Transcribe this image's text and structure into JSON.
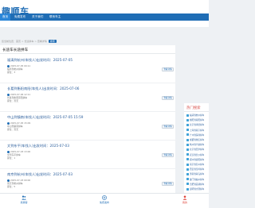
{
  "header": {
    "logo": "趣顺车"
  },
  "nav": [
    {
      "label": "首页"
    },
    {
      "label": "免费发布"
    },
    {
      "label": "关于我们"
    },
    {
      "label": "联系车主"
    }
  ],
  "breadcrumb": {
    "text": "您当前位置：首页 > 长途拼车 > 查看详情",
    "button": "搜索"
  },
  "main": {
    "title": "长途车长途拼车",
    "posts": [
      {
        "title": "福清到杭州(车找人)出发时间：2025-07-05",
        "date": "2025-07-05 09:11",
        "route": "福清到杭州拼车",
        "seats": "座位：3",
        "button": "查看详情"
      },
      {
        "title": "长葛到衡阳南阳(车找人)出发时间：2025-07-06",
        "date": "2025-07-06 12:11",
        "route": "长葛到衡阳南阳拼车",
        "seats": "座位：暂无",
        "button": "查看详情"
      },
      {
        "title": "中山到镇南(车找人)出发时间：2025-07-05 15:59",
        "date": "2025-07-05 15:09",
        "route": "中山到镇南拼车",
        "seats": "座位：暂无",
        "button": "查看详情"
      },
      {
        "title": "文到东平(车找人)出发时间：2025-07-03",
        "date": "2025-07-03 13:00",
        "route": "文到东平拼车",
        "seats": "座位：1",
        "button": "查看详情"
      },
      {
        "title": "南京到杭州(车找人)出发时间：2025-07-03",
        "date": "2025-07-03 09:00",
        "route": "南京到杭州拼车",
        "seats": "座位：5",
        "button": "查看详情"
      }
    ]
  },
  "sidebar": {
    "title": "热门搜索",
    "items": [
      {
        "label": "福清到杭州拼车"
      },
      {
        "label": "衡阳到南阳拼车"
      },
      {
        "label": "北京到承德拼车"
      },
      {
        "label": "上海到南京拼车"
      },
      {
        "label": "广州到深圳拼车"
      },
      {
        "label": "成都到重庆拼车"
      },
      {
        "label": "杭州到宁波拼车"
      },
      {
        "label": "北京到天津拼车"
      },
      {
        "label": "武汉到长沙拼车"
      },
      {
        "label": "郑州到洛阳拼车"
      },
      {
        "label": "南京到苏州拼车"
      },
      {
        "label": "西安到宝鸡拼车"
      },
      {
        "label": "济南到青岛拼车"
      },
      {
        "label": "厦门到福州拼车"
      },
      {
        "label": "合肥到芜湖拼车"
      },
      {
        "label": "昆明到大理拼车"
      }
    ]
  },
  "tabbar": [
    {
      "label": "找乘客",
      "icon": "people-icon"
    },
    {
      "label": "免费发布",
      "icon": "publish-icon"
    },
    {
      "label": "我的",
      "icon": "user-icon"
    }
  ],
  "colors": {
    "brand": "#1f6db5",
    "hot": "#d9534f",
    "active_tab": "#e0443a"
  }
}
